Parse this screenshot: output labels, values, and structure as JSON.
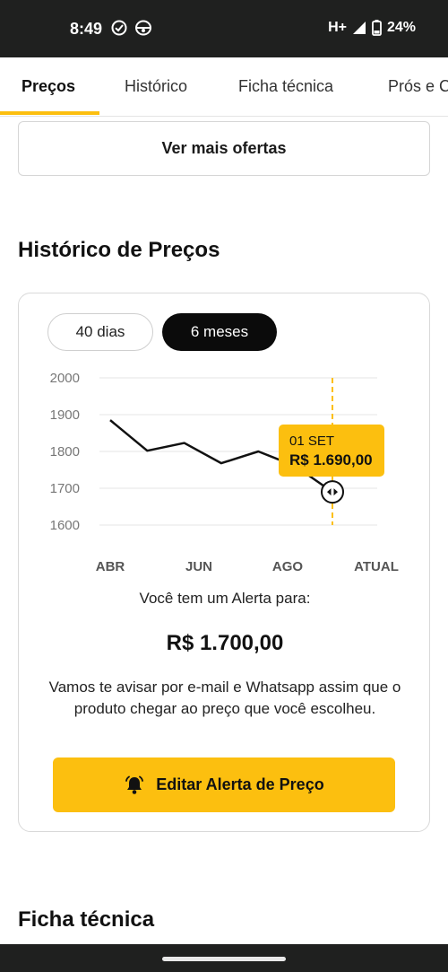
{
  "status_bar": {
    "time": "8:49",
    "network": "H+",
    "battery": "24%",
    "icons": [
      "check-circle-icon",
      "sync-icon",
      "signal-icon",
      "battery-icon"
    ]
  },
  "tabs": [
    {
      "label": "Preços",
      "active": true
    },
    {
      "label": "Histórico",
      "active": false
    },
    {
      "label": "Ficha técnica",
      "active": false
    },
    {
      "label": "Prós e C",
      "active": false
    }
  ],
  "ver_mais_label": "Ver mais ofertas",
  "history": {
    "title": "Histórico de Preços",
    "range_options": [
      "40 dias",
      "6 meses"
    ],
    "selected_range": "6 meses",
    "alert_label": "Você tem um Alerta para:",
    "alert_price": "R$ 1.700,00",
    "alert_desc": "Vamos te avisar por e-mail e Whatsapp assim que o produto chegar ao preço que você escolheu.",
    "edit_button": "Editar Alerta de Preço"
  },
  "chart_data": {
    "type": "line",
    "categories": [
      "ABR",
      "JUN",
      "AGO",
      "ATUAL"
    ],
    "yticks": [
      "2000",
      "1900",
      "1800",
      "1700",
      "1600"
    ],
    "ylim": [
      1600,
      2000
    ],
    "x": [
      0,
      1,
      2,
      3,
      4,
      5,
      6
    ],
    "values": [
      1885,
      1802,
      1823,
      1768,
      1800,
      1760,
      1690
    ],
    "grid": true,
    "marker_index": 6,
    "tooltip": {
      "date": "01 SET",
      "price": "R$ 1.690,00"
    },
    "colors": {
      "line": "#111111",
      "accent": "#fcbf0f"
    }
  },
  "next_section_title": "Ficha técnica"
}
